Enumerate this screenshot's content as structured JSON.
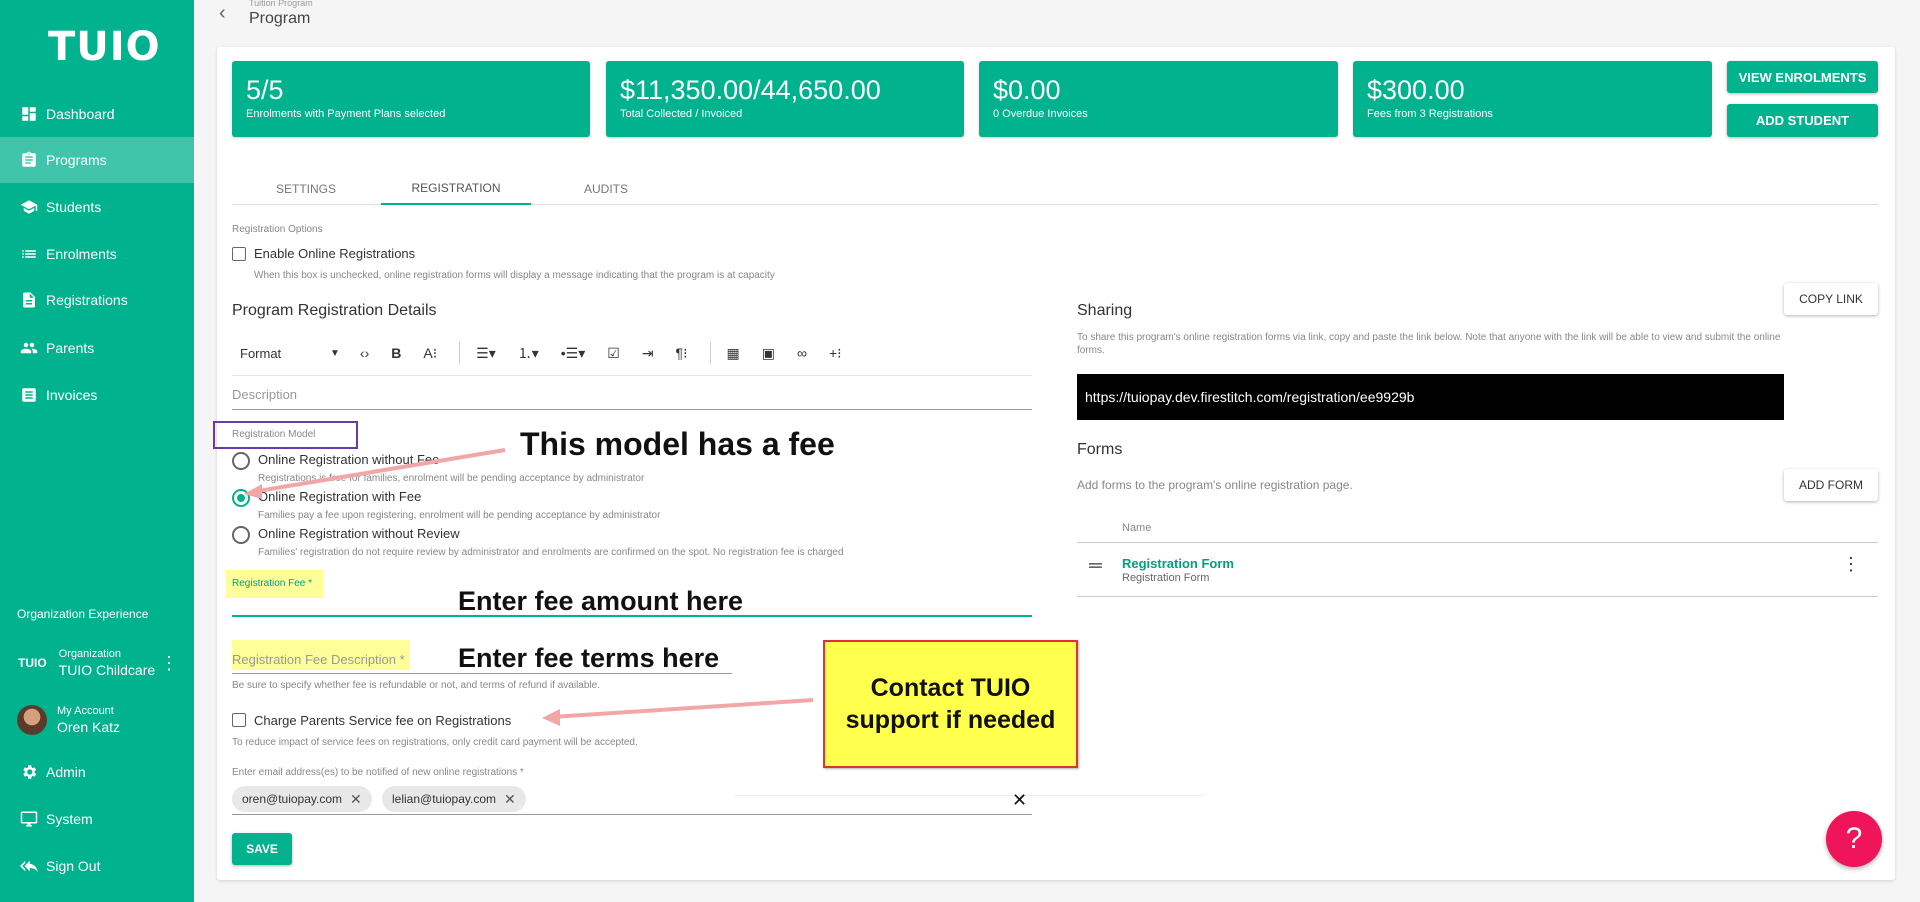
{
  "sidebar": {
    "logo": "TUIO",
    "items": [
      {
        "label": "Dashboard",
        "icon": "dashboard-icon"
      },
      {
        "label": "Programs",
        "icon": "clipboard-icon"
      },
      {
        "label": "Students",
        "icon": "school-cap-icon"
      },
      {
        "label": "Enrolments",
        "icon": "list-icon"
      },
      {
        "label": "Registrations",
        "icon": "document-icon"
      },
      {
        "label": "Parents",
        "icon": "people-icon"
      },
      {
        "label": "Invoices",
        "icon": "receipt-icon"
      }
    ],
    "org_heading": "Organization Experience",
    "organization": {
      "small": "Organization",
      "name": "TUIO Childcare",
      "mini_logo": "TUIO"
    },
    "account": {
      "small": "My Account",
      "name": "Oren Katz"
    },
    "bottom_items": [
      {
        "label": "Admin",
        "icon": "gear-icon"
      },
      {
        "label": "System",
        "icon": "monitor-icon"
      },
      {
        "label": "Sign Out",
        "icon": "sign-out-icon"
      }
    ]
  },
  "header": {
    "breadcrumb_small": "Tuition Program",
    "title": "Program"
  },
  "stats": [
    {
      "value": "5/5",
      "label": "Enrolments with Payment Plans selected"
    },
    {
      "value": "$11,350.00/44,650.00",
      "label": "Total Collected / Invoiced"
    },
    {
      "value": "$0.00",
      "label": "0 Overdue Invoices"
    },
    {
      "value": "$300.00",
      "label": "Fees from 3 Registrations"
    }
  ],
  "actions": {
    "view_enrolments": "VIEW ENROLMENTS",
    "add_student": "ADD STUDENT"
  },
  "tabs": [
    "SETTINGS",
    "REGISTRATION",
    "AUDITS"
  ],
  "registration": {
    "options_label": "Registration Options",
    "enable_online": "Enable Online Registrations",
    "enable_online_help": "When this box is unchecked, online registration forms will display a message indicating that the program is at capacity",
    "details_title": "Program Registration Details",
    "toolbar_format": "Format",
    "description_placeholder": "Description",
    "model_label": "Registration Model",
    "models": [
      {
        "label": "Online Registration without Fee",
        "help": "Registrations is free for families, enrolment will be pending acceptance by administrator",
        "selected": false
      },
      {
        "label": "Online Registration with Fee",
        "help": "Families pay a fee upon registering, enrolment will be pending acceptance by administrator",
        "selected": true
      },
      {
        "label": "Online Registration without Review",
        "help": "Families' registration do not require review by administrator and enrolments are confirmed on the spot. No registration fee is charged",
        "selected": false
      }
    ],
    "fee_label": "Registration Fee *",
    "fee_desc_label": "Registration Fee Description *",
    "fee_desc_help": "Be sure to specify whether fee is refundable or not, and terms of refund if available.",
    "service_fee": "Charge Parents Service fee on Registrations",
    "service_fee_help": "To reduce impact of service fees on registrations, only credit card payment will be accepted.",
    "emails_label": "Enter email address(es) to be notified of new online registrations *",
    "emails": [
      "oren@tuiopay.com",
      "lelian@tuiopay.com"
    ],
    "save": "SAVE"
  },
  "sharing": {
    "title": "Sharing",
    "help": "To share this program's online registration forms via link, copy and paste the link below. Note that anyone with the link will be able to view and submit the online forms.",
    "copy_link": "COPY LINK",
    "url": "https://tuiopay.dev.firestitch.com/registration/ee9929b"
  },
  "forms": {
    "title": "Forms",
    "help": "Add forms to the program's online registration page.",
    "add_form": "ADD FORM",
    "column_name": "Name",
    "rows": [
      {
        "name": "Registration Form",
        "subtitle": "Registration Form"
      }
    ]
  },
  "annotations": {
    "model_note": "This model has a fee",
    "fee_note": "Enter fee amount here",
    "terms_note": "Enter fee terms here",
    "support_note_1": "Contact TUIO",
    "support_note_2": "support if needed"
  },
  "help_button": "?",
  "colors": {
    "brand": "#00b28e",
    "fab": "#f0145a",
    "note": "#ffff4d",
    "highlight": "#ffff99"
  }
}
